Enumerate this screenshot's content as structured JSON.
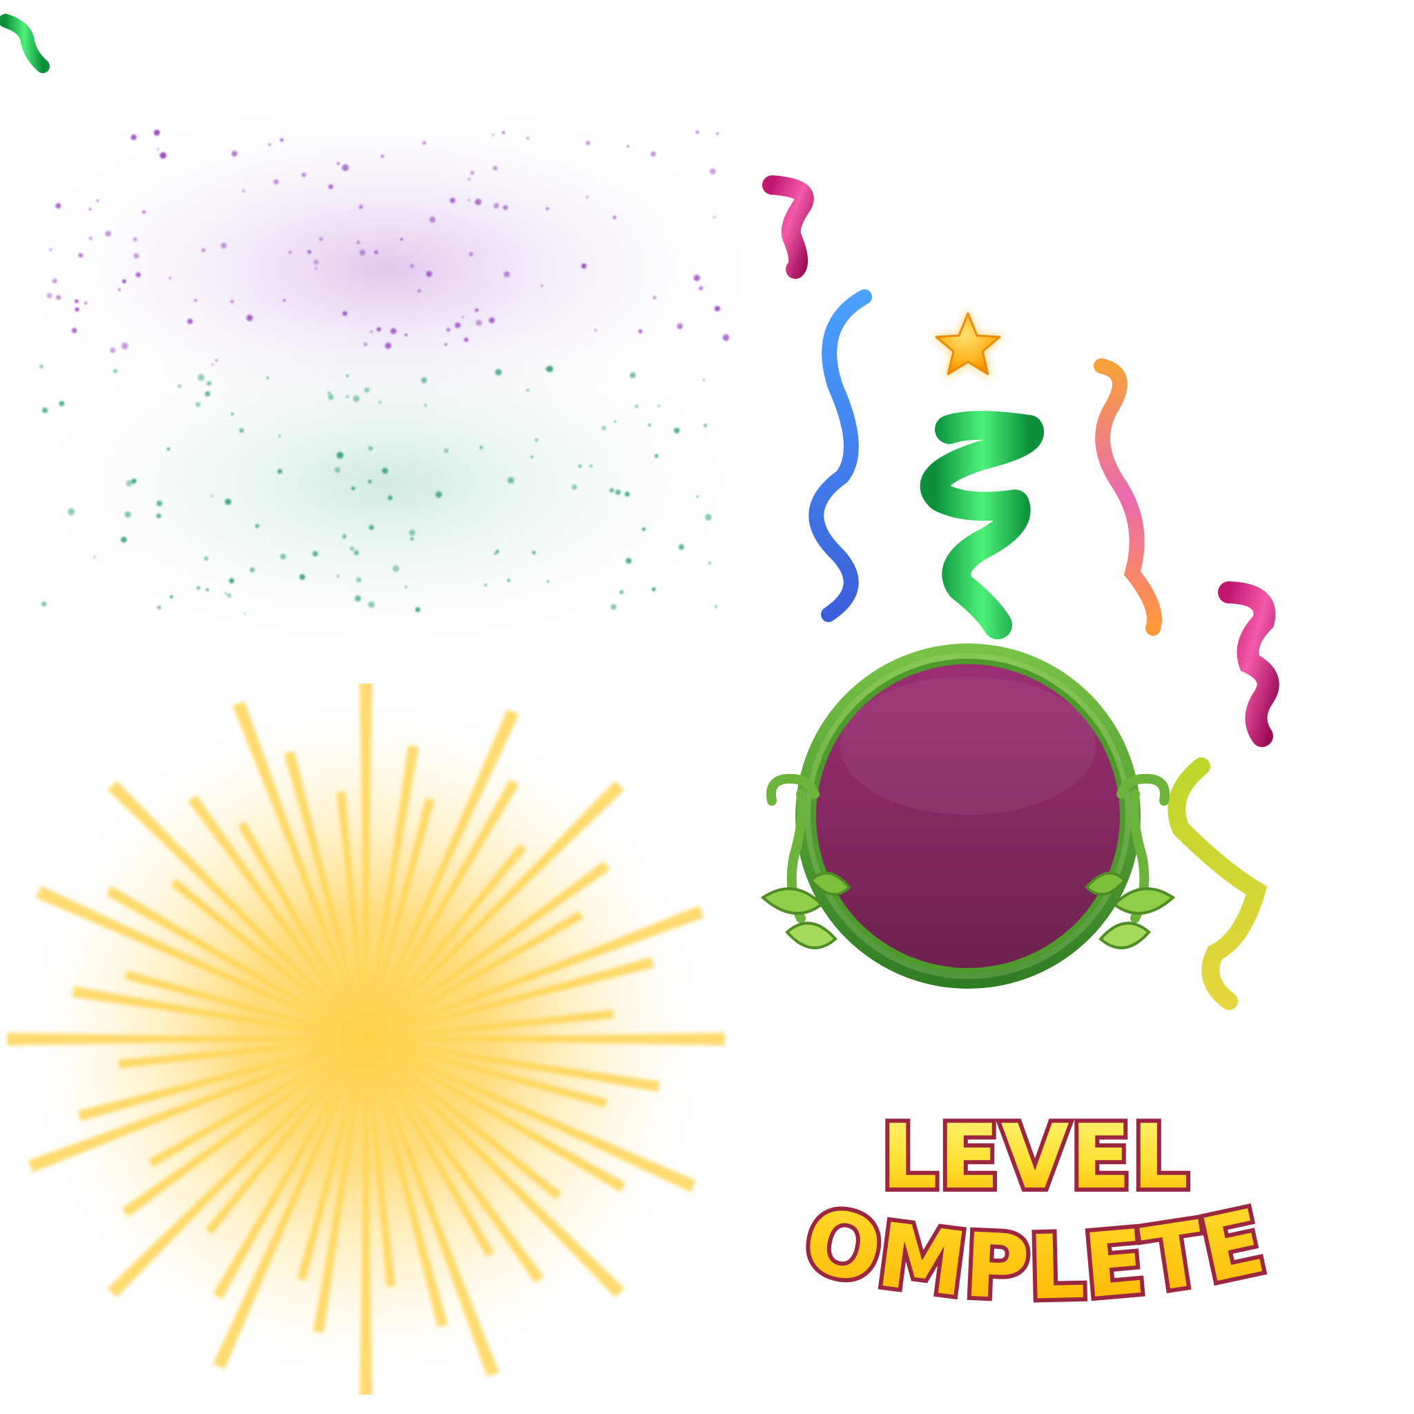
{
  "title": {
    "line1": "LEVEL",
    "line2": "COMPLETED"
  },
  "colors": {
    "badge_fill_top": "#9b2f72",
    "badge_fill_bottom": "#6e2150",
    "badge_ring": "#4f9e2c",
    "title_fill": "#ffe133",
    "title_outline": "#9b2640",
    "sunburst": "#ffcf40",
    "sparkle_purple": "#9a4fc0",
    "sparkle_teal": "#3fa382",
    "star": "#ffb21a"
  },
  "icons": [
    "star-icon",
    "badge-frame",
    "ribbon-streamer",
    "leaf-icon"
  ]
}
